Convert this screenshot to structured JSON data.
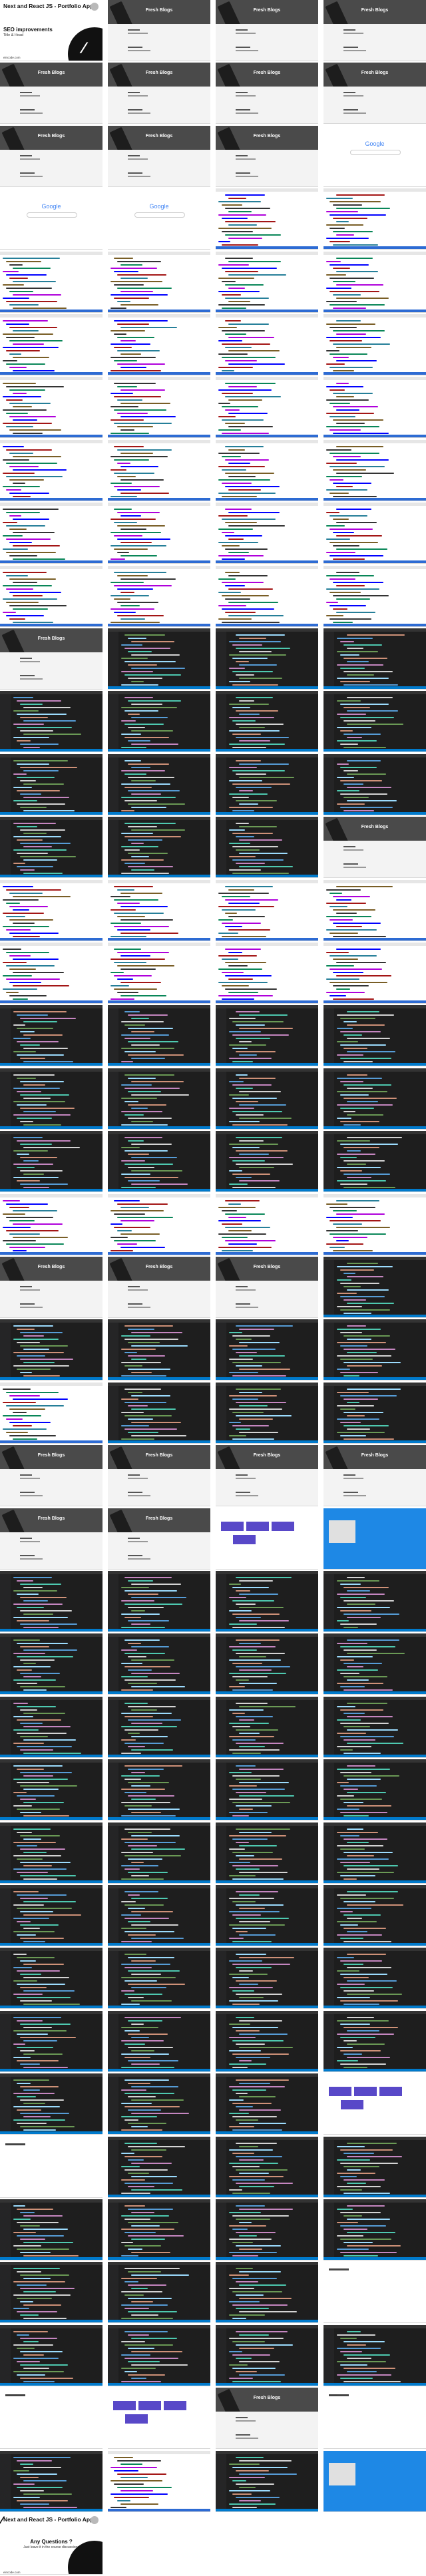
{
  "title_slide": {
    "heading": "Next and React JS - Portfolio App",
    "topic": "SEO improvements",
    "subtitle": "Title & Head",
    "site": "eincode.com"
  },
  "end_slide": {
    "heading": "Next and React JS - Portfolio App",
    "question": "Any Questions ?",
    "note": "Just leave it in the course discussions",
    "site": "eincode.com"
  },
  "fresh_blogs_title": "Fresh Blogs",
  "google_logo": "Google",
  "frame_types": [
    "title",
    "fresh",
    "fresh",
    "fresh",
    "fresh",
    "fresh",
    "fresh",
    "fresh",
    "fresh",
    "fresh",
    "fresh",
    "google",
    "google",
    "devlight",
    "devlight",
    "devlight",
    "devlight",
    "devlight",
    "devlight",
    "devlight",
    "devlight",
    "devlight",
    "devlight",
    "devlight",
    "devlight",
    "devlight",
    "devlight",
    "devlight",
    "devlight",
    "devlight",
    "devlight",
    "devlight",
    "devlight",
    "devlight",
    "devlight",
    "devlight",
    "devlight",
    "devlight",
    "devlight",
    "devlight",
    "devlight",
    "devlight",
    "devlight",
    "devlight",
    "devlight",
    "devlight",
    "devlight",
    "devlight",
    "devlight",
    "devlight",
    "devlight",
    "devlight",
    "devlight",
    "devlight",
    "devlight",
    "devlight",
    "devlight",
    "devlight",
    "devlight",
    "devlight",
    "devlight",
    "devlight",
    "devlight",
    "devlight",
    "devlight",
    "devlight",
    "devlight",
    "devlight",
    "devlight",
    "devlight",
    "devlight",
    "devlight",
    "devlight",
    "devlight",
    "devlight",
    "devlight",
    "devlight",
    "devlight",
    "devlight",
    "devlight",
    "devlight",
    "devlight",
    "devlight",
    "devlight",
    "devlight",
    "devlight",
    "devlight",
    "devlight",
    "devlight",
    "devlight",
    "devlight",
    "devlight",
    "devlight",
    "devlight",
    "devlight",
    "devlight",
    "devlight",
    "devlight",
    "devlight",
    "devlight",
    "devlight",
    "devlight",
    "devlight",
    "devlight",
    "devlight",
    "devlight",
    "devlight",
    "devlight",
    "devlight",
    "devlight",
    "devlight",
    "devlight",
    "devlight",
    "devlight",
    "devlight",
    "devlight",
    "devlight",
    "devlight",
    "devlight",
    "devlight",
    "devlight",
    "devlight",
    "devlight",
    "devlight",
    "devlight",
    "devlight",
    "devlight",
    "devlight",
    "devlight",
    "devlight",
    "devlight",
    "devlight",
    "devlight",
    "devlight",
    "devlight",
    "devlight",
    "devlight",
    "devlight",
    "devlight",
    "devlight",
    "devlight",
    "devlight",
    "devlight",
    "devlight",
    "devlight",
    "devlight",
    "devlight",
    "devlight",
    "devlight",
    "devlight",
    "devlight",
    "devlight",
    "devlight",
    "devlight",
    "devlight",
    "devlight",
    "devlight",
    "devlight",
    "devlight",
    "devlight",
    "devlight",
    "devlight",
    "devlight",
    "devlight",
    "devlight",
    "devlight",
    "devlight",
    "devlight",
    "devlight",
    "devlight",
    "devlight",
    "devlight",
    "devlight",
    "devlight",
    "devlight",
    "devlight",
    "devlight",
    "devlight",
    "devlight",
    "devlight",
    "devlight",
    "devlight",
    "devlight",
    "devlight",
    "devlight",
    "devlight",
    "devlight",
    "devlight",
    "devlight",
    "devlight",
    "devlight",
    "devlight",
    "devlight",
    "devlight",
    "devlight",
    "devlight",
    "devlight",
    "devlight",
    "devlight",
    "devlight",
    "devlight",
    "devlight",
    "devlight",
    "devlight",
    "devlight",
    "devlight",
    "devlight",
    "devlight"
  ],
  "rows": [
    [
      "title",
      "fresh",
      "fresh",
      "fresh"
    ],
    [
      "fresh",
      "fresh",
      "fresh",
      "fresh"
    ],
    [
      "fresh",
      "fresh",
      "fresh",
      "google"
    ],
    [
      "google",
      "google",
      "devlight",
      "devlight"
    ],
    [
      "devlight",
      "devlight",
      "devlight",
      "devlight"
    ],
    [
      "devlight",
      "devlight",
      "devlight",
      "devlight"
    ],
    [
      "devlight",
      "devlight",
      "devlight",
      "devlight"
    ],
    [
      "devlight",
      "devlight",
      "devlight",
      "devlight"
    ],
    [
      "devlight",
      "devlight",
      "devlight",
      "devlight"
    ],
    [
      "devlight",
      "devlight",
      "devlight",
      "devlight"
    ],
    [
      "fresh",
      "devdark",
      "devdark",
      "devdark"
    ],
    [
      "devdark",
      "devdark",
      "devdark",
      "devdark"
    ],
    [
      "devdark",
      "devdark",
      "devdark",
      "devdark"
    ],
    [
      "devdark",
      "devdark",
      "devdark",
      "fresh"
    ],
    [
      "devlight",
      "devlight",
      "devlight",
      "devlight"
    ],
    [
      "devlight",
      "devlight",
      "devlight",
      "devlight"
    ],
    [
      "devdark",
      "devdark",
      "devdark",
      "devdark"
    ],
    [
      "devdark",
      "devdark",
      "devdark",
      "devdark"
    ],
    [
      "devdark",
      "devdark",
      "devdark",
      "devdark"
    ],
    [
      "devlight",
      "devlight",
      "devlight",
      "devlight"
    ],
    [
      "fresh",
      "fresh",
      "fresh",
      "devdark"
    ],
    [
      "devdark",
      "devdark",
      "devdark",
      "devdark"
    ],
    [
      "devlight",
      "devdark",
      "devdark",
      "devdark"
    ],
    [
      "fresh",
      "fresh",
      "fresh",
      "fresh"
    ],
    [
      "fresh",
      "fresh",
      "purple",
      "blue"
    ],
    [
      "devdark",
      "devdark",
      "devdark",
      "devdark"
    ],
    [
      "devdark",
      "devdark",
      "devdark",
      "devdark"
    ],
    [
      "devdark",
      "devdark",
      "devdark",
      "devdark"
    ],
    [
      "devdark",
      "devdark",
      "devdark",
      "devdark"
    ],
    [
      "devdark",
      "devdark",
      "devdark",
      "devdark"
    ],
    [
      "devdark",
      "devdark",
      "devdark",
      "devdark"
    ],
    [
      "devdark",
      "devdark",
      "devdark",
      "devdark"
    ],
    [
      "devdark",
      "devdark",
      "devdark",
      "devdark"
    ],
    [
      "devdark",
      "devdark",
      "devdark",
      "purple"
    ],
    [
      "blank",
      "devdark",
      "devdark",
      "devdark"
    ],
    [
      "devdark",
      "devdark",
      "devdark",
      "devdark"
    ],
    [
      "devdark",
      "devdark",
      "devdark",
      "blank"
    ],
    [
      "devdark",
      "devdark",
      "devdark",
      "devdark"
    ],
    [
      "blank",
      "purple",
      "fresh",
      "blank"
    ],
    [
      "devdark",
      "devlight",
      "devdark",
      "blue"
    ],
    [
      "end"
    ]
  ]
}
